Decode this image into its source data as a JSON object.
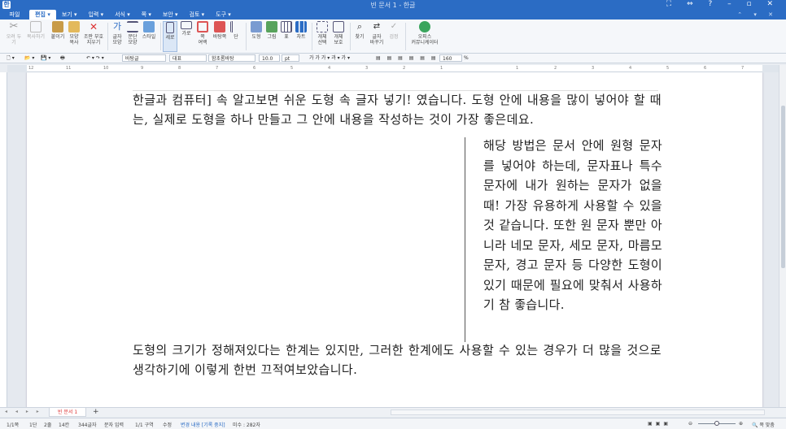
{
  "window": {
    "title": "빈 문서 1 - 한글",
    "controls": "⛶ ⇔ ? – ▫ ✕"
  },
  "menu": {
    "file": "파일",
    "items": [
      "편집 ▾",
      "보기 ▾",
      "입력 ▾",
      "서식 ▾",
      "쪽 ▾",
      "보안 ▾",
      "검토 ▾",
      "도구 ▾"
    ],
    "right": "⌃ ▾ ✕"
  },
  "ribbon": {
    "buttons": [
      {
        "label": "오려\n두기",
        "icon": "scissors-icon"
      },
      {
        "label": "복사하기",
        "icon": "copy-icon"
      },
      {
        "label": "붙이기",
        "icon": "paste-icon"
      },
      {
        "label": "모양\n복사",
        "icon": "format-painter-icon"
      },
      {
        "label": "조판 부호\n지우기",
        "icon": "clear-format-icon"
      },
      {
        "label": "글자\n모양",
        "icon": "char-shape-icon"
      },
      {
        "label": "문단\n모양",
        "icon": "para-shape-icon"
      },
      {
        "label": "스타일",
        "icon": "style-icon"
      },
      {
        "label": "세로",
        "icon": "portrait-icon"
      },
      {
        "label": "가로",
        "icon": "landscape-icon"
      },
      {
        "label": "쪽\n여백",
        "icon": "margin-icon"
      },
      {
        "label": "바탕쪽",
        "icon": "master-page-icon"
      },
      {
        "label": "단",
        "icon": "columns-icon"
      },
      {
        "label": "도형",
        "icon": "shape-icon"
      },
      {
        "label": "그림",
        "icon": "picture-icon"
      },
      {
        "label": "표",
        "icon": "table-icon"
      },
      {
        "label": "차트",
        "icon": "chart-icon"
      },
      {
        "label": "개체\n선택",
        "icon": "select-object-icon"
      },
      {
        "label": "개체\n보호",
        "icon": "protect-object-icon"
      },
      {
        "label": "찾기",
        "icon": "find-icon"
      },
      {
        "label": "글자\n바꾸기",
        "icon": "replace-icon"
      },
      {
        "label": "검정",
        "icon": "check-icon"
      },
      {
        "label": "오피스\n커뮤니케이터",
        "icon": "communicator-icon"
      }
    ]
  },
  "format_bar": {
    "style": "바탕글",
    "lang": "대표",
    "font": "함초롬바탕",
    "size": "10.0",
    "unit": "pt",
    "bold_italic": "가 가 가 ▾ 과 ▾ 가 ▾",
    "zoom": "160",
    "zoom_unit": "%"
  },
  "ruler": {
    "ticks": [
      "12",
      "11",
      "10",
      "9",
      "8",
      "7",
      "6",
      "5",
      "4",
      "3",
      "2",
      "1",
      "1",
      "2",
      "3",
      "4",
      "5",
      "6",
      "7"
    ]
  },
  "document": {
    "para1": "한글과 컴퓨터] 속 알고보면 쉬운 도형 속 글자 넣기! 였습니다. 도형 안에 내용을 많이 넣어야 할 때는, 실제로 도형을 하나 만들고 그 안에 내용을 작성하는 것이 가장 좋은데요.",
    "box_text": "해당 방법은 문서 안에 원형 문자를 넣어야 하는데, 문자표나 특수 문자에 내가 원하는 문자가 없을 때! 가장 유용하게 사용할 수 있을 것 같습니다. 또한 원 문자 뿐만 아니라 네모 문자, 세모 문자, 마름모 문자, 경고 문자 등 다양한 도형이 있기 때문에 필요에 맞춰서 사용하기 참 좋습니다.",
    "para3": "도형의 크기가 정해져있다는 한계는 있지만, 그러한 한계에도 사용할 수 있는 경우가 더 많을 것으로 생각하기에 이렇게 한번 끄적여보았습니다."
  },
  "tabs": {
    "doc_tab": "빈 문서 1",
    "add": "+"
  },
  "status": {
    "page": "1/1쪽",
    "section": "1단",
    "line": "2줄",
    "col": "14칸",
    "chars": "344글자",
    "mode": "문자 입력",
    "area": "1/1 구역",
    "edit": "수정",
    "track": "변경 내용 [기록 중지]",
    "hint": "미수 : 282자",
    "zoom_btn": "🔍 쪽 맞춤"
  }
}
